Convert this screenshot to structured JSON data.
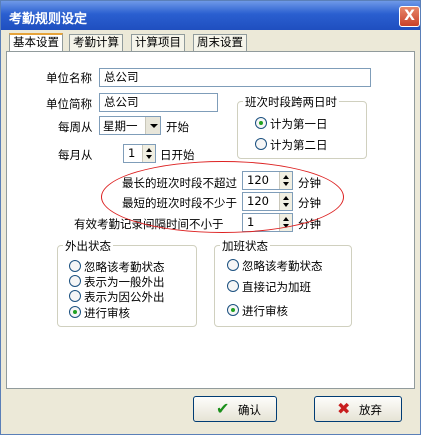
{
  "window": {
    "title": "考勤规则设定",
    "close_glyph": "X"
  },
  "tabs": [
    {
      "label": "基本设置",
      "active": true
    },
    {
      "label": "考勤计算",
      "active": false
    },
    {
      "label": "计算项目",
      "active": false
    },
    {
      "label": "周末设置",
      "active": false
    }
  ],
  "form": {
    "unit_name_label": "单位名称",
    "unit_name_value": "总公司",
    "unit_short_label": "单位简称",
    "unit_short_value": "总公司",
    "week_from_label": "每周从",
    "week_from_value": "星期一",
    "week_from_suffix": "开始",
    "month_from_label": "每月从",
    "month_from_value": "1",
    "month_from_suffix": "日开始",
    "max_shift_label": "最长的班次时段不超过",
    "max_shift_value": "120",
    "max_shift_unit": "分钟",
    "min_shift_label": "最短的班次时段不少于",
    "min_shift_value": "120",
    "min_shift_unit": "分钟",
    "min_interval_label": "有效考勤记录间隔时间不小于",
    "min_interval_value": "1",
    "min_interval_unit": "分钟"
  },
  "cross_day_group": {
    "title": "班次时段跨两日时",
    "options": [
      {
        "label": "计为第一日",
        "selected": true
      },
      {
        "label": "计为第二日",
        "selected": false
      }
    ]
  },
  "out_group": {
    "title": "外出状态",
    "options": [
      {
        "label": "忽略该考勤状态",
        "selected": false
      },
      {
        "label": "表示为一般外出",
        "selected": false
      },
      {
        "label": "表示为因公外出",
        "selected": false
      },
      {
        "label": "进行审核",
        "selected": true
      }
    ]
  },
  "overtime_group": {
    "title": "加班状态",
    "options": [
      {
        "label": "忽略该考勤状态",
        "selected": false
      },
      {
        "label": "直接记为加班",
        "selected": false
      },
      {
        "label": "进行审核",
        "selected": true
      }
    ]
  },
  "buttons": {
    "ok_label": "确认",
    "ok_icon": "✔",
    "cancel_label": "放弃",
    "cancel_icon": "✖"
  },
  "colors": {
    "titlebar": "#2a5fd0",
    "ok_icon": "#1a8f1a",
    "cancel_icon": "#c81e1e",
    "highlight": "#dd2222"
  }
}
